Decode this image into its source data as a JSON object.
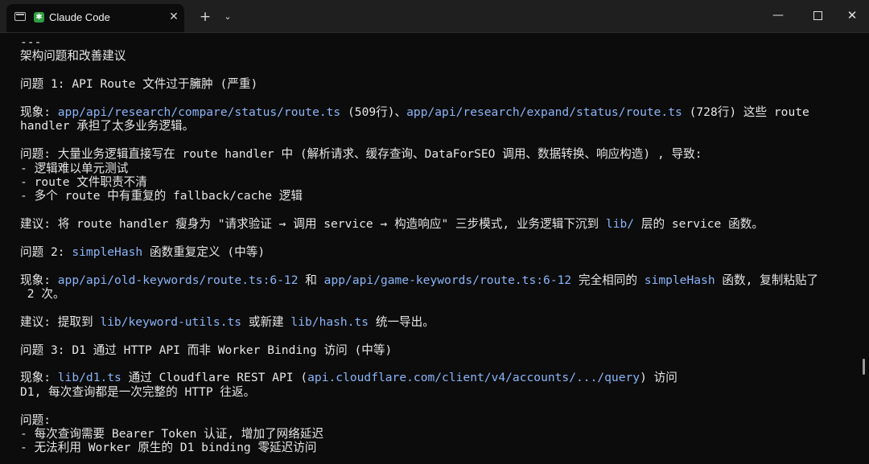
{
  "window": {
    "tab_title": "Claude Code",
    "tab_icon": "claude-icon",
    "new_tab": "+",
    "dropdown": "⌄",
    "minimize": "—",
    "close_tab": "✕",
    "close_window": "✕"
  },
  "terminal": {
    "lines": [
      [
        {
          "t": "---"
        }
      ],
      [
        {
          "t": "架构问题和改善建议"
        }
      ],
      [],
      [
        {
          "t": "问题 1: API Route 文件过于臃肿 (严重)"
        }
      ],
      [],
      [
        {
          "t": "现象: "
        },
        {
          "t": "app/api/research/compare/status/route.ts",
          "c": "path"
        },
        {
          "t": " (509行)、"
        },
        {
          "t": "app/api/research/expand/status/route.ts",
          "c": "path"
        },
        {
          "t": " (728行) 这些 route"
        }
      ],
      [
        {
          "t": "handler 承担了太多业务逻辑。"
        }
      ],
      [],
      [
        {
          "t": "问题: 大量业务逻辑直接写在 route handler 中 (解析请求、缓存查询、DataForSEO 调用、数据转换、响应构造) , 导致:"
        }
      ],
      [
        {
          "t": "- 逻辑难以单元测试"
        }
      ],
      [
        {
          "t": "- route 文件职责不清"
        }
      ],
      [
        {
          "t": "- 多个 route 中有重复的 fallback/cache 逻辑"
        }
      ],
      [],
      [
        {
          "t": "建议: 将 route handler 瘦身为 \"请求验证 → 调用 service → 构造响应\" 三步模式, 业务逻辑下沉到 "
        },
        {
          "t": "lib/",
          "c": "path"
        },
        {
          "t": " 层的 service 函数。"
        }
      ],
      [],
      [
        {
          "t": "问题 2: "
        },
        {
          "t": "simpleHash",
          "c": "path"
        },
        {
          "t": " 函数重复定义 (中等)"
        }
      ],
      [],
      [
        {
          "t": "现象: "
        },
        {
          "t": "app/api/old-keywords/route.ts:6-12",
          "c": "path"
        },
        {
          "t": " 和 "
        },
        {
          "t": "app/api/game-keywords/route.ts:6-12",
          "c": "path"
        },
        {
          "t": " 完全相同的 "
        },
        {
          "t": "simpleHash",
          "c": "path"
        },
        {
          "t": " 函数, 复制粘贴了"
        }
      ],
      [
        {
          "t": " 2 次。"
        }
      ],
      [],
      [
        {
          "t": "建议: 提取到 "
        },
        {
          "t": "lib/keyword-utils.ts",
          "c": "path"
        },
        {
          "t": " 或新建 "
        },
        {
          "t": "lib/hash.ts",
          "c": "path"
        },
        {
          "t": " 统一导出。"
        }
      ],
      [],
      [
        {
          "t": "问题 3: D1 通过 HTTP API 而非 Worker Binding 访问 (中等)"
        }
      ],
      [],
      [
        {
          "t": "现象: "
        },
        {
          "t": "lib/d1.ts",
          "c": "path"
        },
        {
          "t": " 通过 Cloudflare REST API ("
        },
        {
          "t": "api.cloudflare.com/client/v4/accounts/.../query",
          "c": "path"
        },
        {
          "t": ") 访问"
        }
      ],
      [
        {
          "t": "D1, 每次查询都是一次完整的 HTTP 往返。"
        }
      ],
      [],
      [
        {
          "t": "问题:"
        }
      ],
      [
        {
          "t": "- 每次查询需要 Bearer Token 认证, 增加了网络延迟"
        }
      ],
      [
        {
          "t": "- 无法利用 Worker 原生的 D1 binding 零延迟访问"
        }
      ]
    ]
  }
}
